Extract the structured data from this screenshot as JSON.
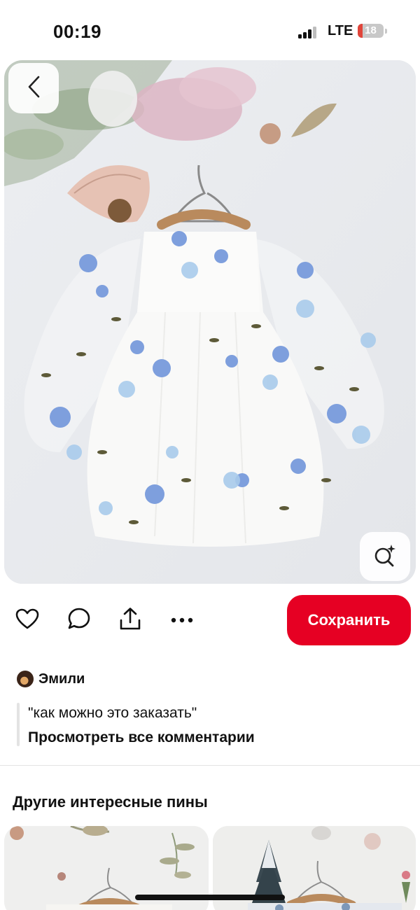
{
  "status_bar": {
    "time": "00:19",
    "network": "LTE",
    "battery_level": "18",
    "battery_fraction": 0.18
  },
  "icons": {
    "back": "chevron-left-icon",
    "visual_search": "visual-search-icon",
    "like": "heart-icon",
    "comment": "comment-icon",
    "share": "share-icon",
    "more": "more-icon"
  },
  "actions": {
    "save_label": "Сохранить"
  },
  "comment": {
    "author": "Эмили",
    "text": "\"как можно это заказать\"",
    "view_all": "Просмотреть все комментарии"
  },
  "more_pins": {
    "heading": "Другие интересные пины"
  },
  "colors": {
    "accent": "#e60023",
    "text": "#111111",
    "battery_low": "#e0453a"
  }
}
